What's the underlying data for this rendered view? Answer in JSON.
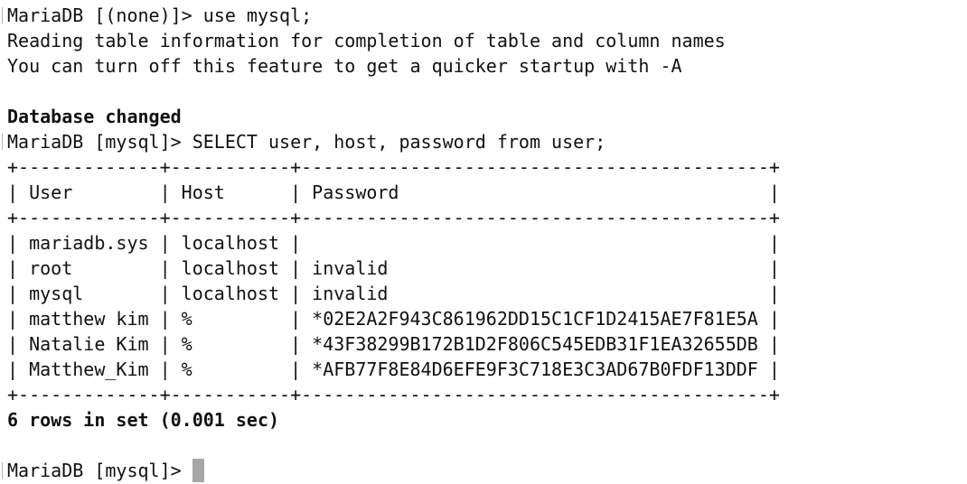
{
  "terminal": {
    "cmd1": "MariaDB [(none)]> use mysql;",
    "info1": "Reading table information for completion of table and column names",
    "info2": "You can turn off this feature to get a quicker startup with -A",
    "db_changed": "Database changed",
    "cmd2": "MariaDB [mysql]> SELECT user, host, password from user;",
    "table": {
      "border": "+-------------+-----------+-------------------------------------------+",
      "header": "| User        | Host      | Password                                  |",
      "rows": [
        "| mariadb.sys | localhost |                                           |",
        "| root        | localhost | invalid                                   |",
        "| mysql       | localhost | invalid                                   |",
        "| matthew kim | %         | *02E2A2F943C861962DD15C1CF1D2415AE7F81E5A |",
        "| Natalie Kim | %         | *43F38299B172B1D2F806C545EDB31F1EA32655DB |",
        "| Matthew_Kim | %         | *AFB77F8E84D6EFE9F3C718E3C3AD67B0FDF13DDF |"
      ],
      "columns": [
        "User",
        "Host",
        "Password"
      ]
    },
    "result": "6 rows in set (0.001 sec)",
    "prompt": "MariaDB [mysql]> "
  }
}
